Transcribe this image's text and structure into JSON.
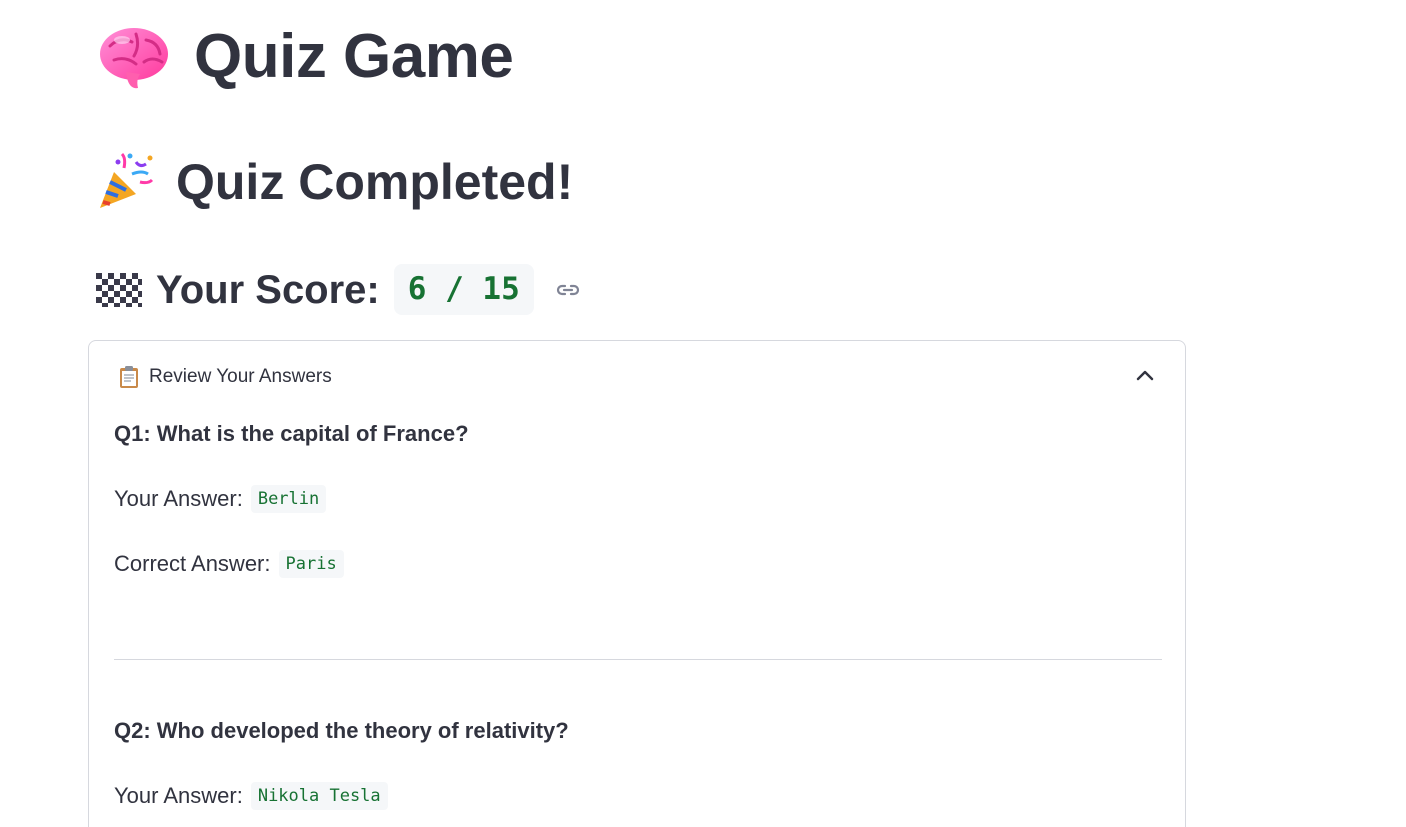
{
  "app": {
    "title": "Quiz Game",
    "icon": "brain-icon"
  },
  "result": {
    "heading": "Quiz Completed!",
    "icon": "party-popper-icon"
  },
  "score": {
    "label": "Your Score:",
    "value": "6 / 15",
    "correct": 6,
    "total": 15,
    "icon": "checkered-flag-icon"
  },
  "review": {
    "label": "Review Your Answers",
    "icon": "clipboard-icon",
    "expanded": true,
    "items": [
      {
        "question": "Q1: What is the capital of France?",
        "your_answer_label": "Your Answer:",
        "your_answer": "Berlin",
        "correct_answer_label": "Correct Answer:",
        "correct_answer": "Paris"
      },
      {
        "question": "Q2: Who developed the theory of relativity?",
        "your_answer_label": "Your Answer:",
        "your_answer": "Nikola Tesla"
      }
    ]
  },
  "colors": {
    "text": "#31333f",
    "code_text": "#177233",
    "code_bg": "#f5f7f9",
    "border": "#d6d8de"
  }
}
